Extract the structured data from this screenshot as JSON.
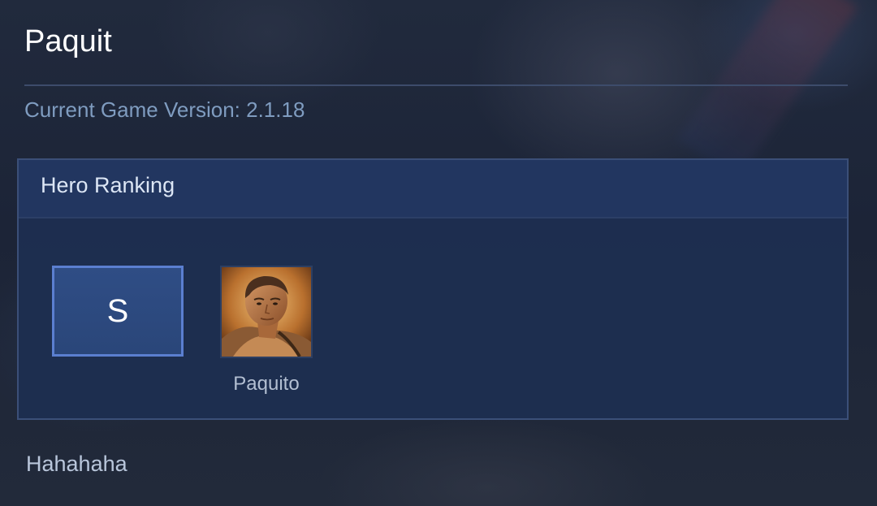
{
  "header": {
    "title": "Paquit",
    "version_text": "Current Game Version: 2.1.18"
  },
  "ranking_panel": {
    "heading": "Hero Ranking",
    "tier": "S",
    "heroes": [
      {
        "name": "Paquito"
      }
    ]
  },
  "footer": {
    "text": "Hahahaha"
  }
}
